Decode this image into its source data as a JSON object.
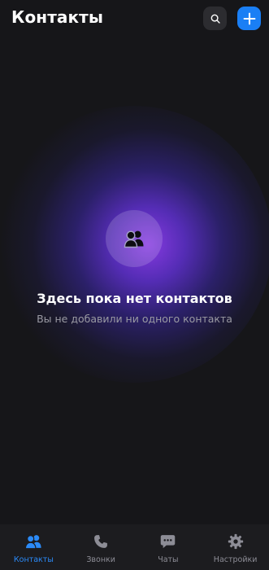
{
  "header": {
    "title": "Контакты",
    "search_icon": "search-icon",
    "add_icon": "plus-icon"
  },
  "empty_state": {
    "icon": "people-icon",
    "title": "Здесь пока нет контактов",
    "subtitle": "Вы не добавили ни одного контакта"
  },
  "tabbar": {
    "tabs": [
      {
        "label": "Контакты",
        "icon": "people-icon",
        "active": true
      },
      {
        "label": "Звонки",
        "icon": "phone-icon",
        "active": false
      },
      {
        "label": "Чаты",
        "icon": "chat-icon",
        "active": false
      },
      {
        "label": "Настройки",
        "icon": "gear-icon",
        "active": false
      }
    ]
  },
  "colors": {
    "background": "#161619",
    "accent": "#1a7ff5",
    "tab_active": "#2b8af7",
    "tab_inactive": "#8d8d96",
    "glow": "#8c3ceb"
  }
}
